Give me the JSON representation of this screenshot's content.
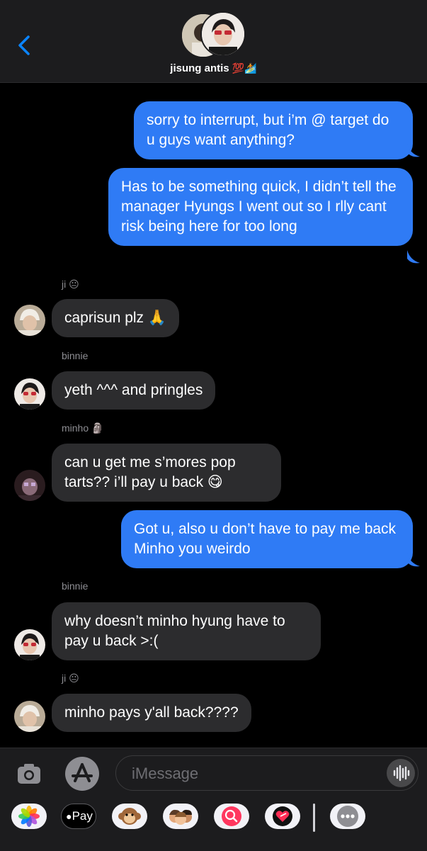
{
  "header": {
    "title": "jisung antis",
    "title_emojis": "💯🏄"
  },
  "messages": [
    {
      "side": "right",
      "text": "sorry to interrupt, but i’m @ target do u guys want anything?"
    },
    {
      "side": "right",
      "text": "Has to be something quick, I didn’t tell the manager Hyungs I went out so I rlly cant risk being here for too long"
    },
    {
      "side": "left",
      "sender": "ji 😐",
      "text": "caprisun plz 🙏"
    },
    {
      "side": "left",
      "sender": "binnie",
      "text": "yeth ^^^ and pringles"
    },
    {
      "side": "left",
      "sender": "minho 🗿",
      "text": "can u get me s’mores pop tarts?? i’ll pay u back 😋"
    },
    {
      "side": "right",
      "text": "Got u, also u don’t have to pay me back Minho you weirdo"
    },
    {
      "side": "left",
      "sender": "binnie",
      "text": "why doesn’t minho hyung have to pay u back >:("
    },
    {
      "side": "left",
      "sender": "ji 😐",
      "text": "minho pays y'all back????"
    }
  ],
  "compose": {
    "placeholder": "iMessage"
  },
  "tray": {
    "apple_pay_label": "Pay"
  },
  "colors": {
    "sent_bubble": "#2f7bf5",
    "received_bubble": "#2c2c2e",
    "accent": "#0a84ff"
  }
}
